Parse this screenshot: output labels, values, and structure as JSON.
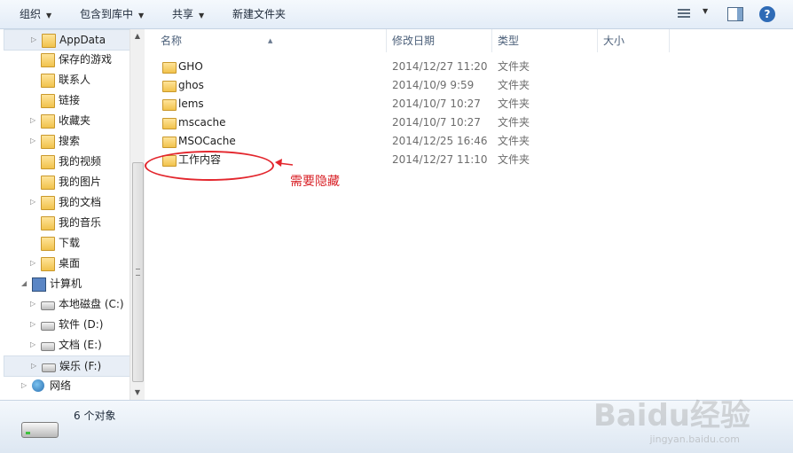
{
  "toolbar": {
    "organize": "组织",
    "include_in_library": "包含到库中",
    "share": "共享",
    "new_folder": "新建文件夹"
  },
  "nav": {
    "items": [
      {
        "label": "AppData",
        "icon": "folder-icon",
        "expandable": true,
        "selected": true
      },
      {
        "label": "保存的游戏",
        "icon": "folder-icon",
        "expandable": false
      },
      {
        "label": "联系人",
        "icon": "folder-icon",
        "expandable": false
      },
      {
        "label": "链接",
        "icon": "folder-icon",
        "expandable": false
      },
      {
        "label": "收藏夹",
        "icon": "folder-icon",
        "expandable": true
      },
      {
        "label": "搜索",
        "icon": "folder-icon",
        "expandable": true
      },
      {
        "label": "我的视频",
        "icon": "folder-icon",
        "expandable": false
      },
      {
        "label": "我的图片",
        "icon": "folder-icon",
        "expandable": false
      },
      {
        "label": "我的文档",
        "icon": "folder-icon",
        "expandable": true
      },
      {
        "label": "我的音乐",
        "icon": "folder-icon",
        "expandable": false
      },
      {
        "label": "下载",
        "icon": "folder-icon",
        "expandable": false
      },
      {
        "label": "桌面",
        "icon": "folder-icon",
        "expandable": true
      },
      {
        "label": "计算机",
        "icon": "computer-icon",
        "expandable": true
      },
      {
        "label": "本地磁盘 (C:)",
        "icon": "drive-icon",
        "expandable": true
      },
      {
        "label": "软件 (D:)",
        "icon": "drive-icon",
        "expandable": true
      },
      {
        "label": "文档 (E:)",
        "icon": "drive-icon",
        "expandable": true
      },
      {
        "label": "娱乐 (F:)",
        "icon": "drive-icon",
        "expandable": true,
        "selected": true
      },
      {
        "label": "网络",
        "icon": "network-icon",
        "expandable": true
      }
    ]
  },
  "columns": {
    "name": "名称",
    "date": "修改日期",
    "type": "类型",
    "size": "大小"
  },
  "files": [
    {
      "name": "GHO",
      "date": "2014/12/27 11:20",
      "type": "文件夹"
    },
    {
      "name": "ghos",
      "date": "2014/10/9 9:59",
      "type": "文件夹"
    },
    {
      "name": "lems",
      "date": "2014/10/7 10:27",
      "type": "文件夹"
    },
    {
      "name": "mscache",
      "date": "2014/10/7 10:27",
      "type": "文件夹"
    },
    {
      "name": "MSOCache",
      "date": "2014/12/25 16:46",
      "type": "文件夹"
    },
    {
      "name": "工作内容",
      "date": "2014/12/27 11:10",
      "type": "文件夹"
    }
  ],
  "annotation": {
    "text": "需要隐藏"
  },
  "status": {
    "text": "6 个对象"
  },
  "watermark": {
    "main": "Baidu经验",
    "sub": "jingyan.baidu.com"
  }
}
